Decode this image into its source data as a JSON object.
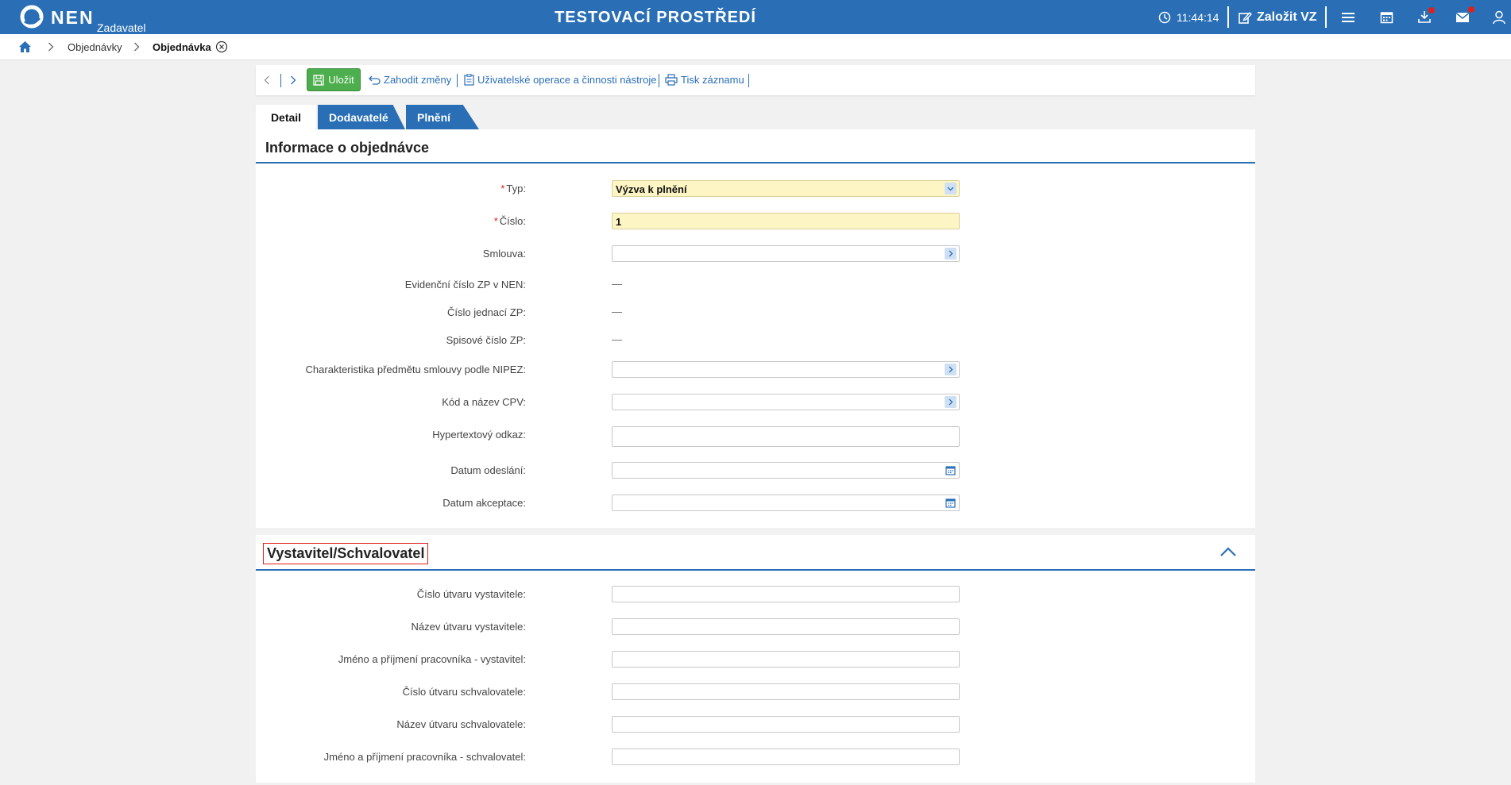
{
  "header": {
    "logo_text": "NEN",
    "logo_sub": "Zadavatel",
    "environment": "TESTOVACÍ PROSTŘEDÍ",
    "time": "11:44:14",
    "new_button": "Založit VZ",
    "icons": [
      "clock-icon",
      "edit-icon",
      "menu-icon",
      "calendar-icon",
      "download-icon",
      "mail-icon",
      "user-icon"
    ]
  },
  "breadcrumb": {
    "items": [
      "Objednávky",
      "Objednávka"
    ]
  },
  "toolbar": {
    "save": "Uložit",
    "discard": "Zahodit změny",
    "operations": "Uživatelské operace a činnosti nástroje",
    "print": "Tisk záznamu"
  },
  "tabs": [
    "Detail",
    "Dodavatelé",
    "Plnění"
  ],
  "section1": {
    "title": "Informace o objednávce",
    "fields": {
      "typ": {
        "label": "Typ:",
        "value": "Výzva k plnění"
      },
      "cislo": {
        "label": "Číslo:",
        "value": "1"
      },
      "smlouva": {
        "label": "Smlouva:",
        "value": ""
      },
      "evidencni": {
        "label": "Evidenční číslo ZP v NEN:",
        "value": "—"
      },
      "jednaci": {
        "label": "Číslo jednací ZP:",
        "value": "—"
      },
      "spisove": {
        "label": "Spisové číslo ZP:",
        "value": "—"
      },
      "nipez": {
        "label": "Charakteristika předmětu smlouvy podle NIPEZ:",
        "value": ""
      },
      "cpv": {
        "label": "Kód a název CPV:",
        "value": ""
      },
      "odkaz": {
        "label": "Hypertextový odkaz:",
        "value": ""
      },
      "odeslani": {
        "label": "Datum odeslání:",
        "value": ""
      },
      "akceptace": {
        "label": "Datum akceptace:",
        "value": ""
      }
    }
  },
  "section2": {
    "title": "Vystavitel/Schvalovatel",
    "fields": {
      "cislo_vyst": {
        "label": "Číslo útvaru vystavitele:",
        "value": ""
      },
      "nazev_vyst": {
        "label": "Název útvaru vystavitele:",
        "value": ""
      },
      "jmeno_vyst": {
        "label": "Jméno a příjmení pracovníka - vystavitel:",
        "value": ""
      },
      "cislo_schv": {
        "label": "Číslo útvaru schvalovatele:",
        "value": ""
      },
      "nazev_schv": {
        "label": "Název útvaru schvalovatele:",
        "value": ""
      },
      "jmeno_schv": {
        "label": "Jméno a příjmení pracovníka - schvalovatel:",
        "value": ""
      }
    }
  },
  "colors": {
    "brand": "#2a6fb6",
    "save": "#4cae4c",
    "required": "#e0201c",
    "highlight": "#fdf5c4"
  }
}
